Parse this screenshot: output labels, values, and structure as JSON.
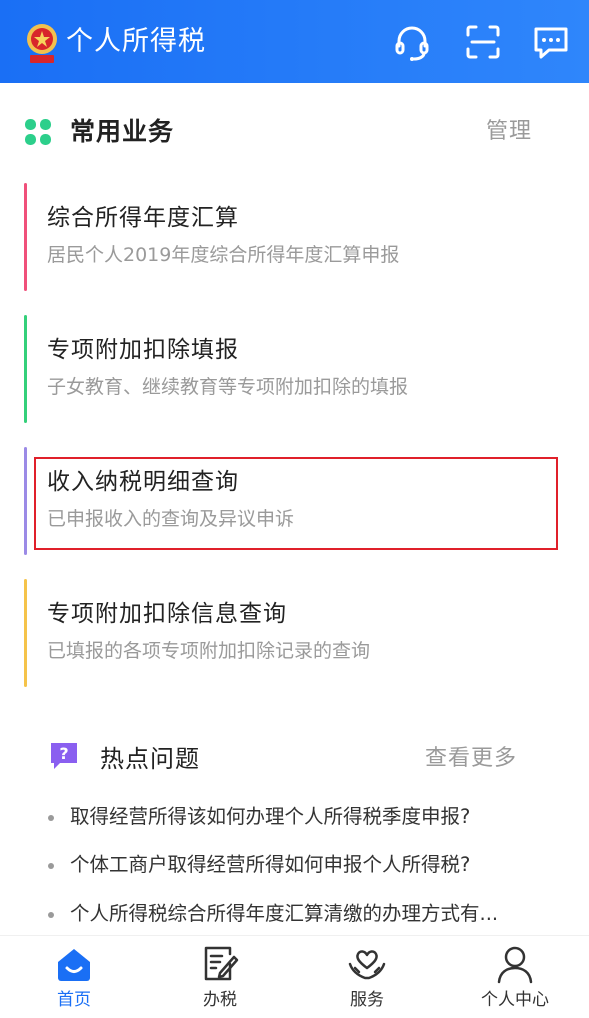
{
  "header": {
    "title": "个人所得税",
    "icons": [
      "emblem-icon",
      "headset-icon",
      "scan-icon",
      "message-icon"
    ]
  },
  "common": {
    "title": "常用业务",
    "manage": "管理",
    "cards": [
      {
        "title": "综合所得年度汇算",
        "subtitle": "居民个人2019年度综合所得年度汇算申报",
        "color": "#f0507a"
      },
      {
        "title": "专项附加扣除填报",
        "subtitle": "子女教育、继续教育等专项附加扣除的填报",
        "color": "#34d07a"
      },
      {
        "title": "收入纳税明细查询",
        "subtitle": "已申报收入的查询及异议申诉",
        "color": "#9b8ae6"
      },
      {
        "title": "专项附加扣除信息查询",
        "subtitle": "已填报的各项专项附加扣除记录的查询",
        "color": "#f5c34a"
      }
    ]
  },
  "hot": {
    "title": "热点问题",
    "more": "查看更多",
    "items": [
      "取得经营所得该如何办理个人所得税季度申报?",
      "个体工商户取得经营所得如何申报个人所得税?",
      "个人所得税综合所得年度汇算清缴的办理方式有..."
    ]
  },
  "tabbar": {
    "tabs": [
      {
        "label": "首页",
        "icon": "home-icon",
        "active": true
      },
      {
        "label": "办税",
        "icon": "document-edit-icon",
        "active": false
      },
      {
        "label": "服务",
        "icon": "heart-hands-icon",
        "active": false
      },
      {
        "label": "个人中心",
        "icon": "person-icon",
        "active": false
      }
    ],
    "accent": "#1a6ff5"
  }
}
